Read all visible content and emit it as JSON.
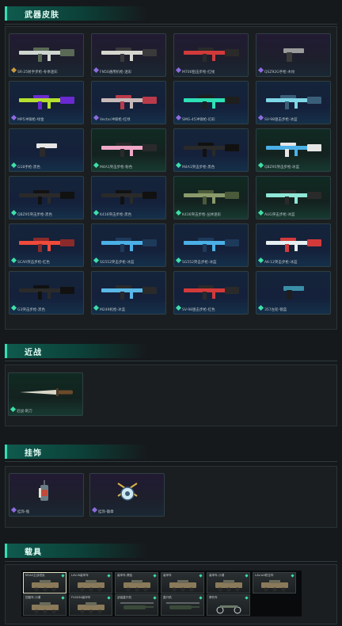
{
  "sections": {
    "weapons": "武器皮肤",
    "melee": "近战",
    "accessories": "挂饰",
    "vehicles": "载具"
  },
  "weapons": [
    {
      "label": "SR-25射手步枪-冬季迷彩",
      "rarity": "purple",
      "marker": "#c89a3a",
      "icon": "sniper-rifle-camo-icon"
    },
    {
      "label": "FN50通用机枪-迷彩",
      "rarity": "purple",
      "marker": "#8f6be0",
      "icon": "machine-gun-camo-icon"
    },
    {
      "label": "M700狙击步枪-红线",
      "rarity": "purple",
      "marker": "#8f6be0",
      "icon": "sniper-rifle-red-icon"
    },
    {
      "label": "QSZ92G手枪-木纹",
      "rarity": "purple",
      "marker": "#8f6be0",
      "icon": "pistol-wood-icon"
    },
    {
      "label": "MP5冲锋枪-绿金",
      "rarity": "blue",
      "marker": "#8f6be0",
      "icon": "smg-green-icon"
    },
    {
      "label": "Vector冲锋枪-红绿",
      "rarity": "blue",
      "marker": "#8f6be0",
      "icon": "vector-smg-icon"
    },
    {
      "label": "SMG-45冲锋枪-幻彩",
      "rarity": "blue",
      "marker": "#8f6be0",
      "icon": "smg-teal-icon"
    },
    {
      "label": "SV-98狙击步枪-冰蓝",
      "rarity": "blue",
      "marker": "#8f6be0",
      "icon": "sniper-rifle-blue-icon"
    },
    {
      "label": "G18手枪-黑色",
      "rarity": "blue",
      "marker": "#3ee0a8",
      "icon": "pistol-black-icon"
    },
    {
      "label": "M4A1突击步枪-粉色",
      "rarity": "green",
      "marker": "#3ee0a8",
      "icon": "assault-rifle-pink-icon"
    },
    {
      "label": "M4A1突击步枪-黑色",
      "rarity": "blue",
      "marker": "#3ee0a8",
      "icon": "assault-rifle-black-icon"
    },
    {
      "label": "QBZ95突击步枪-冰蓝",
      "rarity": "green",
      "marker": "#3ee0a8",
      "icon": "bullpup-rifle-icon"
    },
    {
      "label": "QBZ95突击步枪-黑色",
      "rarity": "blue",
      "marker": "#3ee0a8",
      "icon": "rifle-dark-icon"
    },
    {
      "label": "K416突击步枪-黑色",
      "rarity": "blue",
      "marker": "#3ee0a8",
      "icon": "rifle-dark-icon"
    },
    {
      "label": "K416突击步枪-丛林迷彩",
      "rarity": "green",
      "marker": "#3ee0a8",
      "icon": "rifle-camo-icon"
    },
    {
      "label": "AUG突击步枪-冰蓝",
      "rarity": "green",
      "marker": "#3ee0a8",
      "icon": "aug-rifle-icon"
    },
    {
      "label": "SCAR突击步枪-红色",
      "rarity": "blue",
      "marker": "#3ee0a8",
      "icon": "rifle-red-icon"
    },
    {
      "label": "SG552突击步枪-冰蓝",
      "rarity": "blue",
      "marker": "#3ee0a8",
      "icon": "rifle-blue-icon"
    },
    {
      "label": "SG552突击步枪-冰蓝",
      "rarity": "blue",
      "marker": "#3ee0a8",
      "icon": "rifle-blue-icon"
    },
    {
      "label": "AK-12突击步枪-冰蓝",
      "rarity": "blue",
      "marker": "#3ee0a8",
      "icon": "ak-rifle-icon"
    },
    {
      "label": "G3突击步枪-黑色",
      "rarity": "blue",
      "marker": "#3ee0a8",
      "icon": "rifle-dark-icon"
    },
    {
      "label": "M249机枪-冰蓝",
      "rarity": "blue",
      "marker": "#3ee0a8",
      "icon": "lmg-blue-icon"
    },
    {
      "label": "SV-98狙击步枪-红色",
      "rarity": "blue",
      "marker": "#3ee0a8",
      "icon": "sniper-rifle-red-icon"
    },
    {
      "label": "357左轮-钢蓝",
      "rarity": "blue",
      "marker": "#3ee0a8",
      "icon": "revolver-icon"
    }
  ],
  "melee": {
    "label": "近战-刺刀",
    "icon": "knife-icon"
  },
  "accessories": [
    {
      "label": "挂饰-瓶",
      "icon": "trinket-bottle-icon"
    },
    {
      "label": "挂饰-徽章",
      "icon": "trinket-emblem-icon"
    }
  ],
  "vehicles": [
    {
      "label": "M1A2主战坦克",
      "icon": "tank-icon",
      "selected": true
    },
    {
      "label": "LAV-III装甲车",
      "icon": "apc-icon",
      "selected": false
    },
    {
      "label": "装甲车-黑色",
      "icon": "armored-car-icon",
      "selected": false
    },
    {
      "label": "装甲车",
      "icon": "armored-car-icon",
      "selected": false
    },
    {
      "label": "装甲车-沙漠",
      "icon": "armored-car-icon",
      "selected": false
    },
    {
      "label": "LAV-AA防空车",
      "icon": "apc-icon",
      "selected": false
    },
    {
      "label": "四驱车-沙漠",
      "icon": "buggy-icon",
      "selected": false
    },
    {
      "label": "FV4034装甲车",
      "icon": "armored-car-icon",
      "selected": false
    },
    {
      "label": "武装直升机",
      "icon": "helicopter-icon",
      "selected": false
    },
    {
      "label": "直升机",
      "icon": "helicopter-icon",
      "selected": false
    },
    {
      "label": "摩托车",
      "icon": "motorbike-icon",
      "selected": false
    }
  ],
  "colors": {
    "accent": "#2de0b5",
    "background": "#16191c",
    "purple_marker": "#8f6be0",
    "green_marker": "#3ee0a8",
    "gold_marker": "#c89a3a"
  }
}
